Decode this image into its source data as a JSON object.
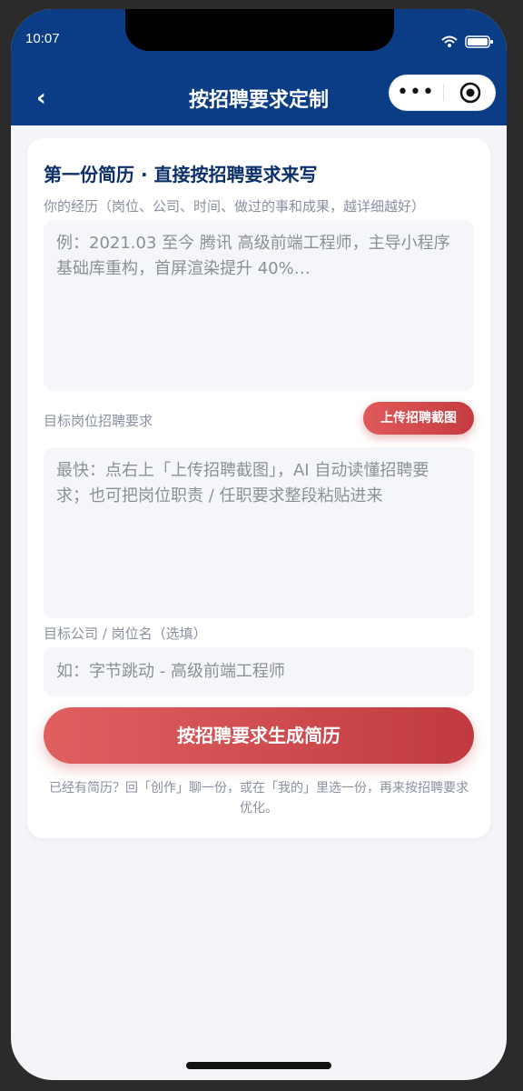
{
  "status_bar": {
    "time": "10:07"
  },
  "nav": {
    "back_label": "‹",
    "title": "按招聘要求定制",
    "more_label": "•••"
  },
  "card": {
    "title": "第一份简历 · 直接按招聘要求来写",
    "experience_label": "你的经历（岗位、公司、时间、做过的事和成果，越详细越好）",
    "experience_placeholder": "例：2021.03 至今 腾讯 高级前端工程师，主导小程序基础库重构，首屏渲染提升 40%…",
    "requirements_label": "目标岗位招聘要求",
    "upload_button": "上传招聘截图",
    "requirements_placeholder": "最快：点右上「上传招聘截图」，AI 自动读懂招聘要求；也可把岗位职责 / 任职要求整段粘贴进来",
    "company_label": "目标公司 / 岗位名（选填）",
    "company_placeholder": "如：字节跳动 - 高级前端工程师",
    "generate_button": "按招聘要求生成简历",
    "hint": "已经有简历？回「创作」聊一份，或在「我的」里选一份，再来按招聘要求优化。"
  },
  "colors": {
    "header_bg": "#0b3c86",
    "title_color": "#0b2f68",
    "accent_red": "#d04a4e",
    "page_bg": "#f3f5f9"
  },
  "icons": {
    "wifi": "wifi-icon",
    "battery": "battery-icon",
    "back": "chevron-left-icon",
    "more": "more-dots-icon",
    "close_target": "target-icon"
  }
}
